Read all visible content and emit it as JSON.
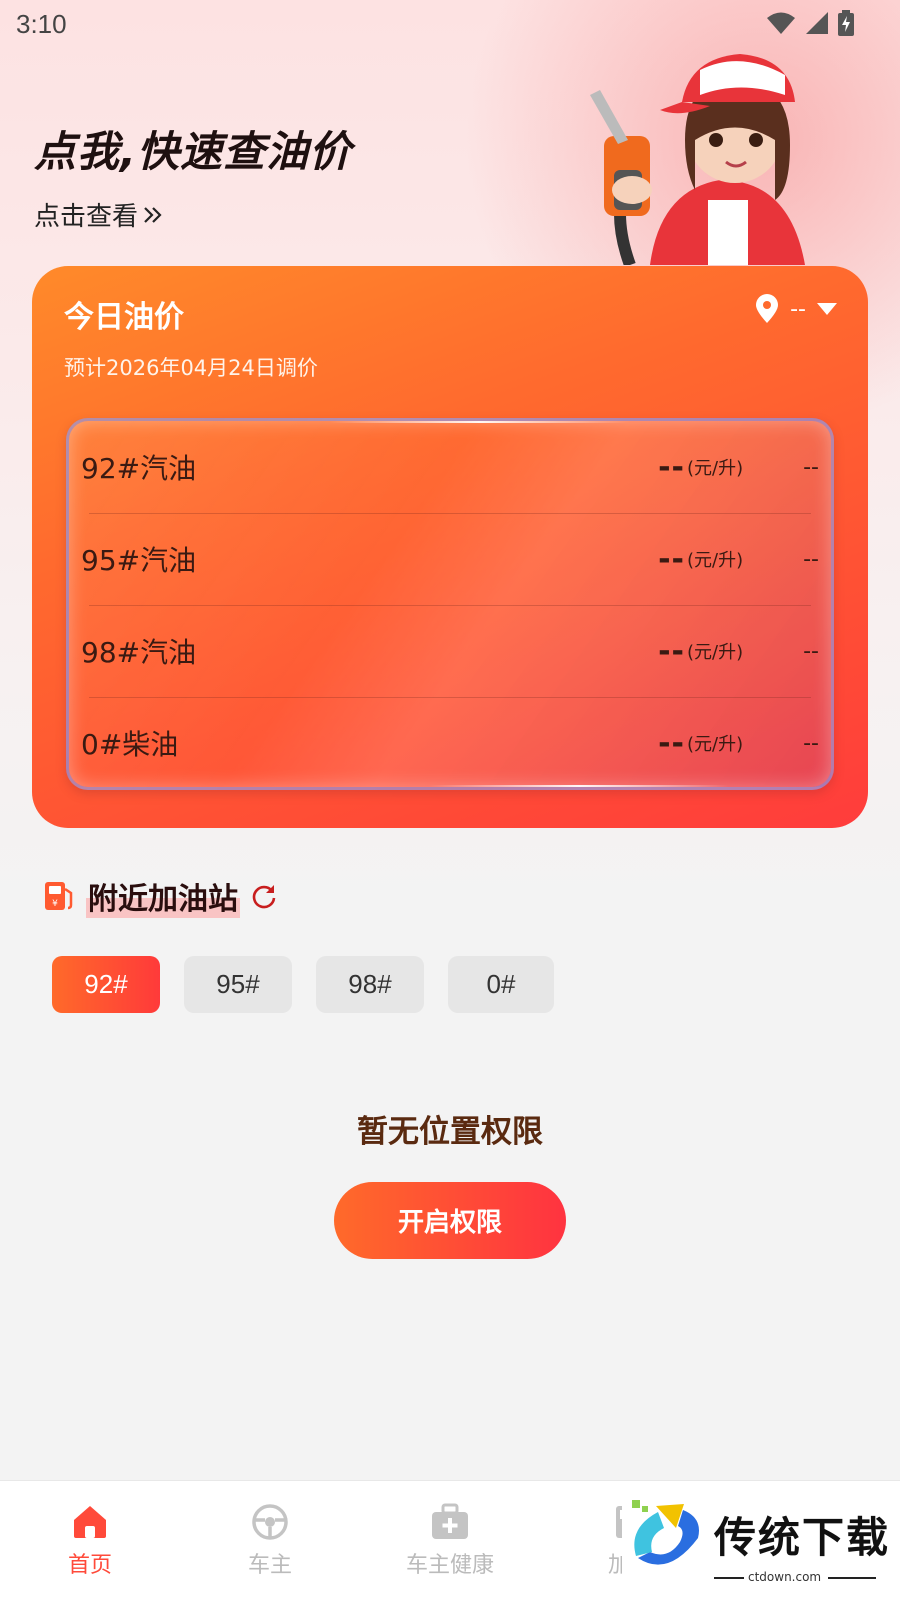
{
  "status_bar": {
    "time": "3:10"
  },
  "hero": {
    "title": "点我,快速查油价",
    "link_label": "点击查看"
  },
  "price_card": {
    "title": "今日油价",
    "subtitle": "预计2026年04月24日调价",
    "location_value": "--",
    "rows": [
      {
        "name": "92#汽油",
        "price": "--",
        "unit": "(元/升)",
        "change": "--"
      },
      {
        "name": "95#汽油",
        "price": "--",
        "unit": "(元/升)",
        "change": "--"
      },
      {
        "name": "98#汽油",
        "price": "--",
        "unit": "(元/升)",
        "change": "--"
      },
      {
        "name": "0#柴油",
        "price": "--",
        "unit": "(元/升)",
        "change": "--"
      }
    ]
  },
  "nearby": {
    "title": "附近加油站",
    "fuel_tabs": [
      "92#",
      "95#",
      "98#",
      "0#"
    ],
    "active_tab": "92#",
    "empty_text": "暂无位置权限",
    "enable_button": "开启权限"
  },
  "tabbar": {
    "items": [
      {
        "label": "首页",
        "icon": "home-icon",
        "active": true
      },
      {
        "label": "车主",
        "icon": "steering-wheel-icon",
        "active": false
      },
      {
        "label": "车主健康",
        "icon": "medical-kit-icon",
        "active": false
      },
      {
        "label": "加油",
        "icon": "fuel-pump-icon",
        "active": false
      }
    ]
  },
  "watermark": {
    "title": "传统下载",
    "url": "ctdown.com"
  },
  "colors": {
    "accent": "#ff4a3a",
    "card_gradient_start": "#ff8a2a",
    "card_gradient_end": "#ff3c3c",
    "inactive_tab": "#bbbbbb"
  }
}
